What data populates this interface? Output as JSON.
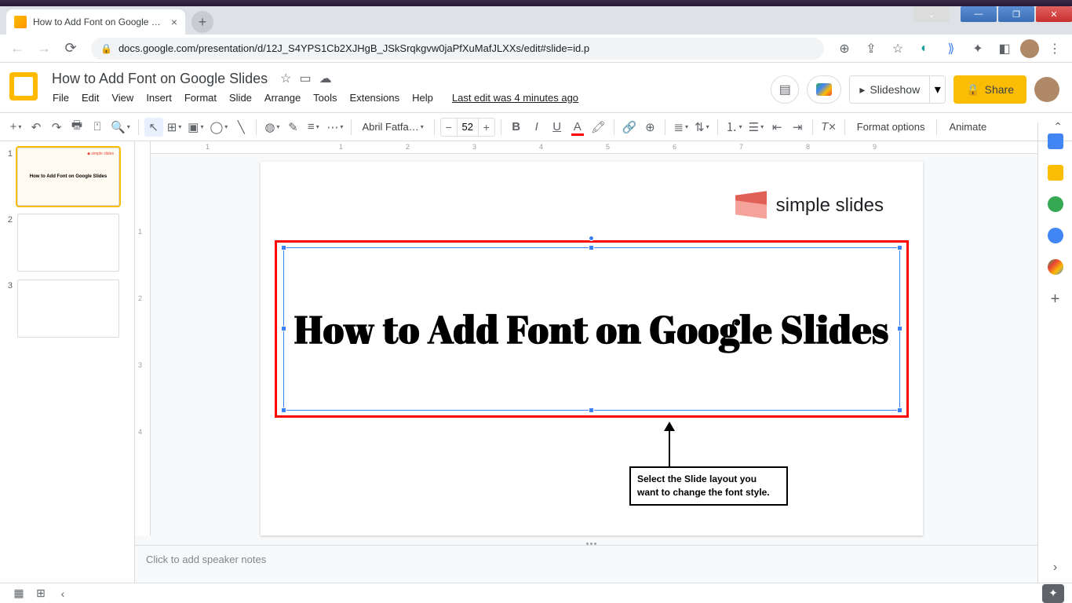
{
  "browser": {
    "tab_title": "How to Add Font on Google Slide",
    "url": "docs.google.com/presentation/d/12J_S4YPS1Cb2XJHgB_JSkSrqkgvw0jaPfXuMafJLXXs/edit#slide=id.p"
  },
  "doc": {
    "title": "How to Add Font on  Google Slides",
    "last_edit": "Last edit was 4 minutes ago"
  },
  "menu": {
    "file": "File",
    "edit": "Edit",
    "view": "View",
    "insert": "Insert",
    "format": "Format",
    "slide": "Slide",
    "arrange": "Arrange",
    "tools": "Tools",
    "extensions": "Extensions",
    "help": "Help"
  },
  "actions": {
    "slideshow": "Slideshow",
    "share": "Share"
  },
  "toolbar": {
    "font_name": "Abril Fatfa…",
    "font_size": "52",
    "format_options": "Format options",
    "animate": "Animate"
  },
  "ruler": {
    "h": [
      "1",
      "",
      "1",
      "2",
      "3",
      "4",
      "5",
      "6",
      "7",
      "8",
      "9"
    ],
    "v": [
      "",
      "1",
      "2",
      "3",
      "4"
    ]
  },
  "thumbs": {
    "t1_num": "1",
    "t1_title": "How to Add Font on Google Slides",
    "t1_logo": "◆ simple slides",
    "t2_num": "2",
    "t3_num": "3"
  },
  "slide": {
    "brand": "simple slides",
    "title": "How to Add Font on Google Slides",
    "callout": "Select the Slide layout you want to change the font style."
  },
  "notes": {
    "placeholder": "Click to add speaker notes"
  }
}
